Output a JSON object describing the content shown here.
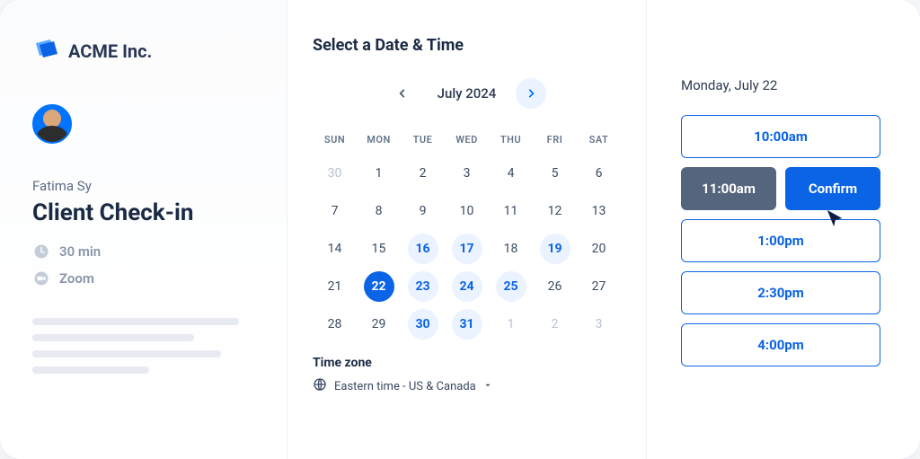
{
  "brand": {
    "name": "ACME Inc."
  },
  "host": {
    "name": "Fatima Sy"
  },
  "meeting": {
    "title": "Client Check-in",
    "duration": "30 min",
    "location": "Zoom"
  },
  "calendar": {
    "heading": "Select a Date & Time",
    "month_label": "July 2024",
    "dow": [
      "SUN",
      "MON",
      "TUE",
      "WED",
      "THU",
      "FRI",
      "SAT"
    ],
    "weeks": [
      [
        {
          "n": "30",
          "muted": true
        },
        {
          "n": "1"
        },
        {
          "n": "2"
        },
        {
          "n": "3"
        },
        {
          "n": "4"
        },
        {
          "n": "5"
        },
        {
          "n": "6"
        }
      ],
      [
        {
          "n": "7"
        },
        {
          "n": "8"
        },
        {
          "n": "9"
        },
        {
          "n": "10"
        },
        {
          "n": "11"
        },
        {
          "n": "12"
        },
        {
          "n": "13"
        }
      ],
      [
        {
          "n": "14"
        },
        {
          "n": "15"
        },
        {
          "n": "16",
          "avail": true
        },
        {
          "n": "17",
          "avail": true
        },
        {
          "n": "18"
        },
        {
          "n": "19",
          "avail": true
        },
        {
          "n": "20"
        }
      ],
      [
        {
          "n": "21"
        },
        {
          "n": "22",
          "selected": true
        },
        {
          "n": "23",
          "avail": true
        },
        {
          "n": "24",
          "avail": true
        },
        {
          "n": "25",
          "avail": true
        },
        {
          "n": "26"
        },
        {
          "n": "27"
        }
      ],
      [
        {
          "n": "28"
        },
        {
          "n": "29"
        },
        {
          "n": "30",
          "avail": true
        },
        {
          "n": "31",
          "avail": true
        },
        {
          "n": "1",
          "muted": true
        },
        {
          "n": "2",
          "muted": true
        },
        {
          "n": "3",
          "muted": true
        }
      ]
    ],
    "timezone_label": "Time zone",
    "timezone_value": "Eastern time - US & Canada"
  },
  "slots": {
    "date_label": "Monday, July 22",
    "items": [
      {
        "time": "10:00am"
      },
      {
        "time": "11:00am",
        "selected": true,
        "confirm_label": "Confirm"
      },
      {
        "time": "1:00pm"
      },
      {
        "time": "2:30pm"
      },
      {
        "time": "4:00pm"
      }
    ]
  }
}
